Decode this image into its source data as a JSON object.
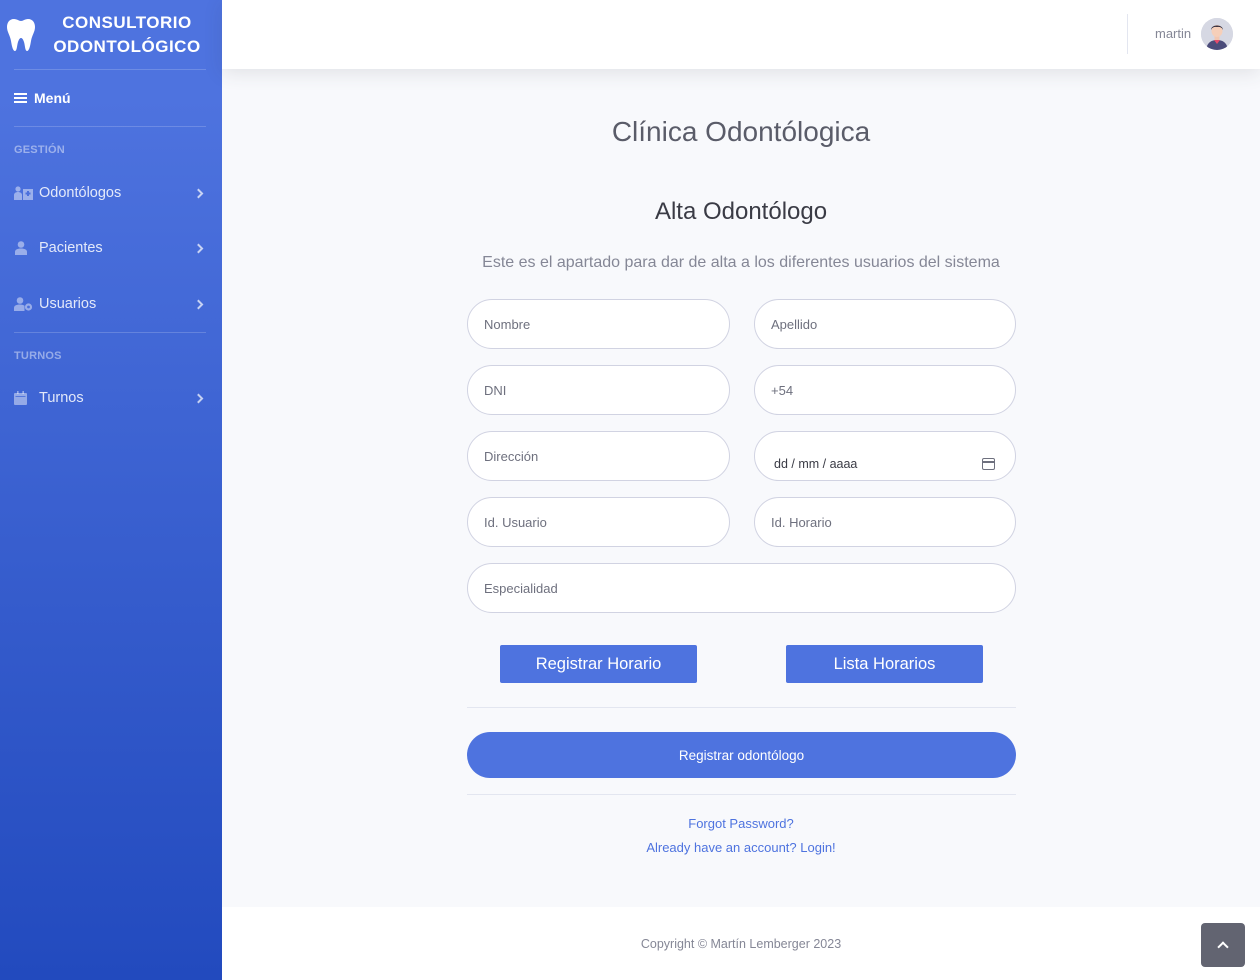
{
  "sidebar": {
    "brand_line1": "CONSULTORIO",
    "brand_line2": "ODONTOLÓGICO",
    "brand_icon": "tooth-icon",
    "menu_label": "Menú",
    "section_gestion": "GESTIÓN",
    "section_turnos": "TURNOS",
    "items": [
      {
        "label": "Odontólogos",
        "icon": "users-hospital-icon"
      },
      {
        "label": "Pacientes",
        "icon": "user-icon"
      },
      {
        "label": "Usuarios",
        "icon": "user-cog-icon"
      },
      {
        "label": "Turnos",
        "icon": "calendar-icon"
      }
    ]
  },
  "topbar": {
    "username": "martin"
  },
  "main": {
    "title": "Clínica Odontólogica",
    "subtitle": "Alta Odontólogo",
    "description": "Este es el apartado para dar de alta a los diferentes usuarios del sistema",
    "fields": {
      "nombre": "Nombre",
      "apellido": "Apellido",
      "dni": "DNI",
      "telefono": "+54",
      "direccion": "Dirección",
      "fecha": "dd / mm / aaaa",
      "id_usuario": "Id. Usuario",
      "id_horario": "Id. Horario",
      "especialidad": "Especialidad"
    },
    "btn_registrar_horario": "Registrar Horario",
    "btn_lista_horarios": "Lista Horarios",
    "btn_registrar": "Registrar odontólogo",
    "link_forgot": "Forgot Password?",
    "link_login": "Already have an account? Login!"
  },
  "footer": {
    "copyright": "Copyright © Martín Lemberger 2023"
  },
  "colors": {
    "primary": "#4e73df",
    "sidebar_bottom": "#224abe",
    "background": "#f8f9fc",
    "text_muted": "#858796"
  }
}
